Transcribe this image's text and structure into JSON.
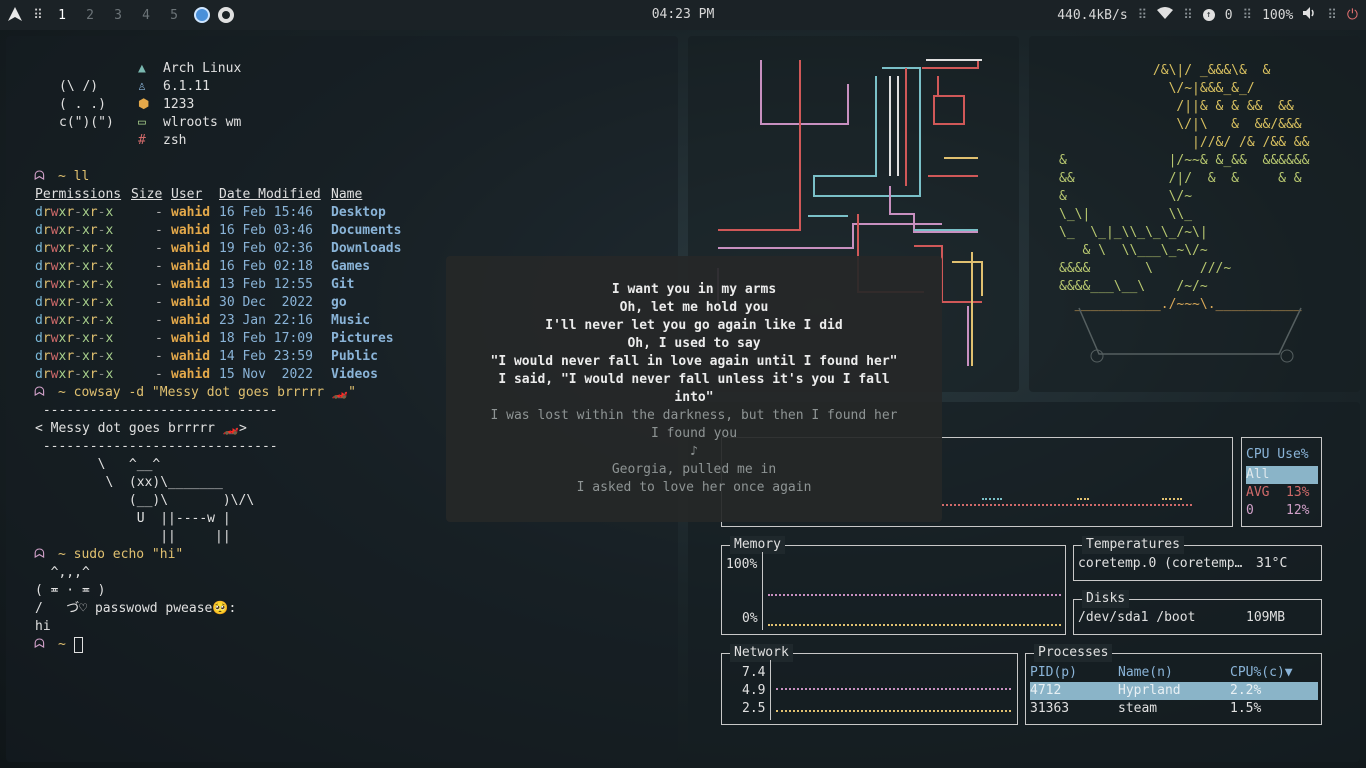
{
  "topbar": {
    "workspaces": [
      "1",
      "2",
      "3",
      "4",
      "5"
    ],
    "clock": "04:23 PM",
    "net_speed": "440.4kB/s",
    "notif_count": "0",
    "battery": "100%"
  },
  "terminal": {
    "fetch_art": [
      "(\\ /)",
      "( . .)",
      "c(\")(\")"
    ],
    "fetch_info": [
      "Arch Linux",
      "6.1.11",
      "1233",
      "wlroots wm",
      "zsh"
    ],
    "prompt1": "~ ll",
    "headers": [
      "Permissions",
      "Size",
      "User",
      "Date Modified",
      "Name"
    ],
    "files": [
      {
        "perm": "drwxr-xr-x",
        "size": "-",
        "user": "wahid",
        "date": "16 Feb 15:46",
        "name": "Desktop"
      },
      {
        "perm": "drwxr-xr-x",
        "size": "-",
        "user": "wahid",
        "date": "16 Feb 03:46",
        "name": "Documents"
      },
      {
        "perm": "drwxr-xr-x",
        "size": "-",
        "user": "wahid",
        "date": "19 Feb 02:36",
        "name": "Downloads"
      },
      {
        "perm": "drwxr-xr-x",
        "size": "-",
        "user": "wahid",
        "date": "16 Feb 02:18",
        "name": "Games"
      },
      {
        "perm": "drwxr-xr-x",
        "size": "-",
        "user": "wahid",
        "date": "13 Feb 12:55",
        "name": "Git"
      },
      {
        "perm": "drwxr-xr-x",
        "size": "-",
        "user": "wahid",
        "date": "30 Dec  2022",
        "name": "go"
      },
      {
        "perm": "drwxr-xr-x",
        "size": "-",
        "user": "wahid",
        "date": "23 Jan 22:16",
        "name": "Music"
      },
      {
        "perm": "drwxr-xr-x",
        "size": "-",
        "user": "wahid",
        "date": "18 Feb 17:09",
        "name": "Pictures"
      },
      {
        "perm": "drwxr-xr-x",
        "size": "-",
        "user": "wahid",
        "date": "14 Feb 23:59",
        "name": "Public"
      },
      {
        "perm": "drwxr-xr-x",
        "size": "-",
        "user": "wahid",
        "date": "15 Nov  2022",
        "name": "Videos"
      }
    ],
    "prompt2": "~ cowsay -d \"Messy dot goes brrrrr 🏎️\"",
    "cowsay": [
      " ------------------------------",
      "< Messy dot goes brrrrr 🏎️>",
      " ------------------------------",
      "        \\   ^__^",
      "         \\  (xx)\\_______",
      "            (__)\\       )\\/\\",
      "             U  ||----w |",
      "                ||     ||"
    ],
    "prompt3": "~ sudo echo \"hi\"",
    "sudo_art": [
      "  ^,,,^",
      "( ≖ · ≖ )",
      "/   づ♡ passwowd pwease🥺:"
    ],
    "output": "hi",
    "prompt4": "~"
  },
  "lyrics": {
    "lines_current": [
      "I want you in my arms",
      "Oh, let me hold you",
      "I'll never let you go again like I did",
      "Oh, I used to say",
      "\"I would never fall in love again until I found her\"",
      "I said, \"I would never fall unless it's you I fall",
      "into\""
    ],
    "lines_next": [
      "I was lost within the darkness, but then I found her",
      "I found you",
      "♪",
      "Georgia, pulled me in",
      "I asked to love her once again"
    ]
  },
  "ascii_art_right": [
    "            /&\\|/ _&&&\\&  &",
    "              \\/~|&&&_&_/",
    "               /||& & & &&  &&",
    "               \\/|\\   &  &&/&&&",
    "                 |//&/ /& /&& &&",
    "&             |/~~& &_&&  &&&&&&",
    "&&            /|/  &  &     & &",
    "&             \\/~",
    "\\_\\|          \\\\_",
    "\\_  \\_|_\\\\_\\_\\_/~\\|",
    "   & \\  \\\\___\\_~\\/~",
    "&&&&       \\      ///~",
    "&&&&___\\__\\    /~/~",
    "  ___________./~~~\\.___________"
  ],
  "btop": {
    "cpu": {
      "title": "CPU Use%",
      "all": "All",
      "avg_label": "AVG",
      "avg": "13%",
      "core_label": "0",
      "core": "12%"
    },
    "memory": {
      "title": "Memory",
      "max": "100%",
      "min": "0%"
    },
    "temperatures": {
      "title": "Temperatures",
      "row": "coretemp.0 (coretemp…",
      "value": "31°C"
    },
    "disks": {
      "title": "Disks",
      "row": "/dev/sda1 /boot",
      "value": "109MB"
    },
    "network": {
      "title": "Network",
      "ticks": [
        "7.4",
        "4.9",
        "2.5"
      ]
    },
    "processes": {
      "title": "Processes",
      "headers": [
        "PID(p)",
        "Name(n)",
        "CPU%(c)▼"
      ],
      "rows": [
        {
          "pid": "4712",
          "name": "Hyprland",
          "cpu": "2.2%"
        },
        {
          "pid": "31363",
          "name": "steam",
          "cpu": "1.5%"
        }
      ]
    }
  },
  "colors": {
    "accent": "#8ab4d8",
    "green": "#a8d08c",
    "pink": "#d0a0c8",
    "yellow": "#e0c070",
    "red": "#d06a6a"
  }
}
